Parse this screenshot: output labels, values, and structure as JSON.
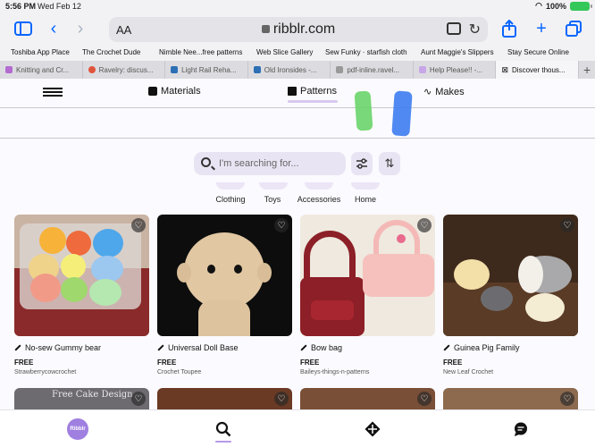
{
  "status": {
    "time": "5:56 PM",
    "date": "Wed Feb 12",
    "battery": "100%"
  },
  "browser": {
    "text_size": "AA",
    "url": "ribblr.com"
  },
  "bookmarks": [
    "Toshiba App Place",
    "The Crochet Dude",
    "Nimble Nee...free patterns",
    "Web Slice Gallery",
    "Sew Funky · starfish cloth",
    "Aunt Maggie's Slippers",
    "Stay Secure Online"
  ],
  "tabs": [
    {
      "label": "Knitting and Cr...",
      "color": "#b36bd0",
      "active": false
    },
    {
      "label": "Ravelry: discus...",
      "color": "#e0553d",
      "active": false
    },
    {
      "label": "Light Rail Reha...",
      "color": "#2c6fb5",
      "active": false
    },
    {
      "label": "Old Ironsides -...",
      "color": "#2c6fb5",
      "active": false
    },
    {
      "label": "pdf-inline.ravel...",
      "color": "#999999",
      "active": false
    },
    {
      "label": "Help Please!! -...",
      "color": "#c8a6e8",
      "active": false
    },
    {
      "label": "Discover thous...",
      "color": "#555555",
      "active": true
    }
  ],
  "nav": {
    "materials": "Materials",
    "patterns": "Patterns",
    "makes": "Makes"
  },
  "search": {
    "placeholder": "I'm searching for..."
  },
  "categories": [
    "Clothing",
    "Toys",
    "Accessories",
    "Home"
  ],
  "cards": [
    {
      "title": "No-sew Gummy bear",
      "price": "FREE",
      "author": "Strawberrycowcrochet"
    },
    {
      "title": "Universal Doll Base",
      "price": "FREE",
      "author": "Crochet Toupee"
    },
    {
      "title": "Bow bag",
      "price": "FREE",
      "author": "Baileys-things-n-patterns"
    },
    {
      "title": "Guinea Pig Family",
      "price": "FREE",
      "author": "New Leaf Crochet"
    }
  ],
  "row2": {
    "first_caption": "Free Cake Design"
  },
  "bottom": {
    "logo": "Ribblr"
  },
  "colors": {
    "accent": "#9f7fe0",
    "browser_blue": "#0a66ff"
  }
}
